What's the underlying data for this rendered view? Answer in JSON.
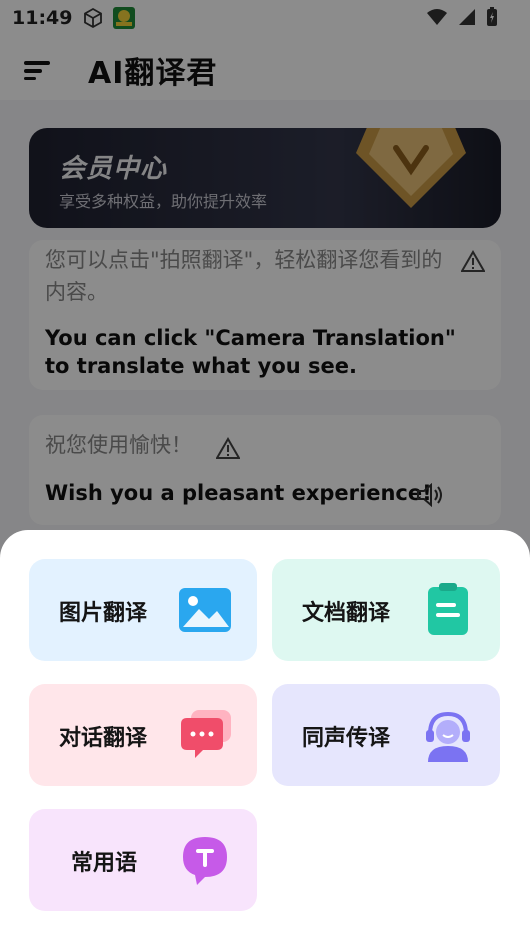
{
  "status": {
    "time": "11:49"
  },
  "header": {
    "title": "AI翻译君"
  },
  "vip": {
    "title": "会员中心",
    "subtitle": "享受多种权益，助你提升效率"
  },
  "tips": [
    {
      "cn": "您可以点击\"拍照翻译\"，轻松翻译您看到的内容。",
      "en": "You can click \"Camera Translation\" to translate what you see."
    },
    {
      "cn": "祝您使用愉快！",
      "en": "Wish you a pleasant experience!"
    }
  ],
  "sheet": {
    "tiles": [
      {
        "label": "图片翻译",
        "bg": "#e3f2ff",
        "accent": "#2aa7ef"
      },
      {
        "label": "文档翻译",
        "bg": "#def8f1",
        "accent": "#21c7a3"
      },
      {
        "label": "对话翻译",
        "bg": "#ffe6ea",
        "accent": "#f04d6a"
      },
      {
        "label": "同声传译",
        "bg": "#e6e6fd",
        "accent": "#7b73f2"
      },
      {
        "label": "常用语",
        "bg": "#f8e4fc",
        "accent": "#c65ae8"
      }
    ]
  }
}
